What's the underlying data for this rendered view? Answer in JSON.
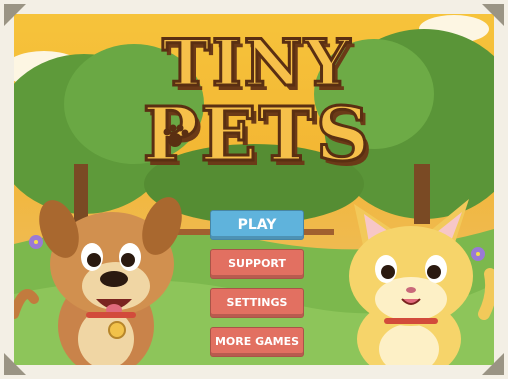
{
  "game": {
    "title_line1": "TINY",
    "title_line2": "PETS"
  },
  "menu": {
    "play": "PLAY",
    "support": "SUPPORT",
    "settings": "SETTINGS",
    "more_games": "MORE GAMES"
  },
  "colors": {
    "play_button": "#5fb3dc",
    "menu_button": "#e27061",
    "logo_fill": "#f6c04a",
    "logo_outline": "#5a2f12"
  },
  "icons": [
    "paw-icon",
    "dog-character",
    "cat-character",
    "flower-icon"
  ]
}
